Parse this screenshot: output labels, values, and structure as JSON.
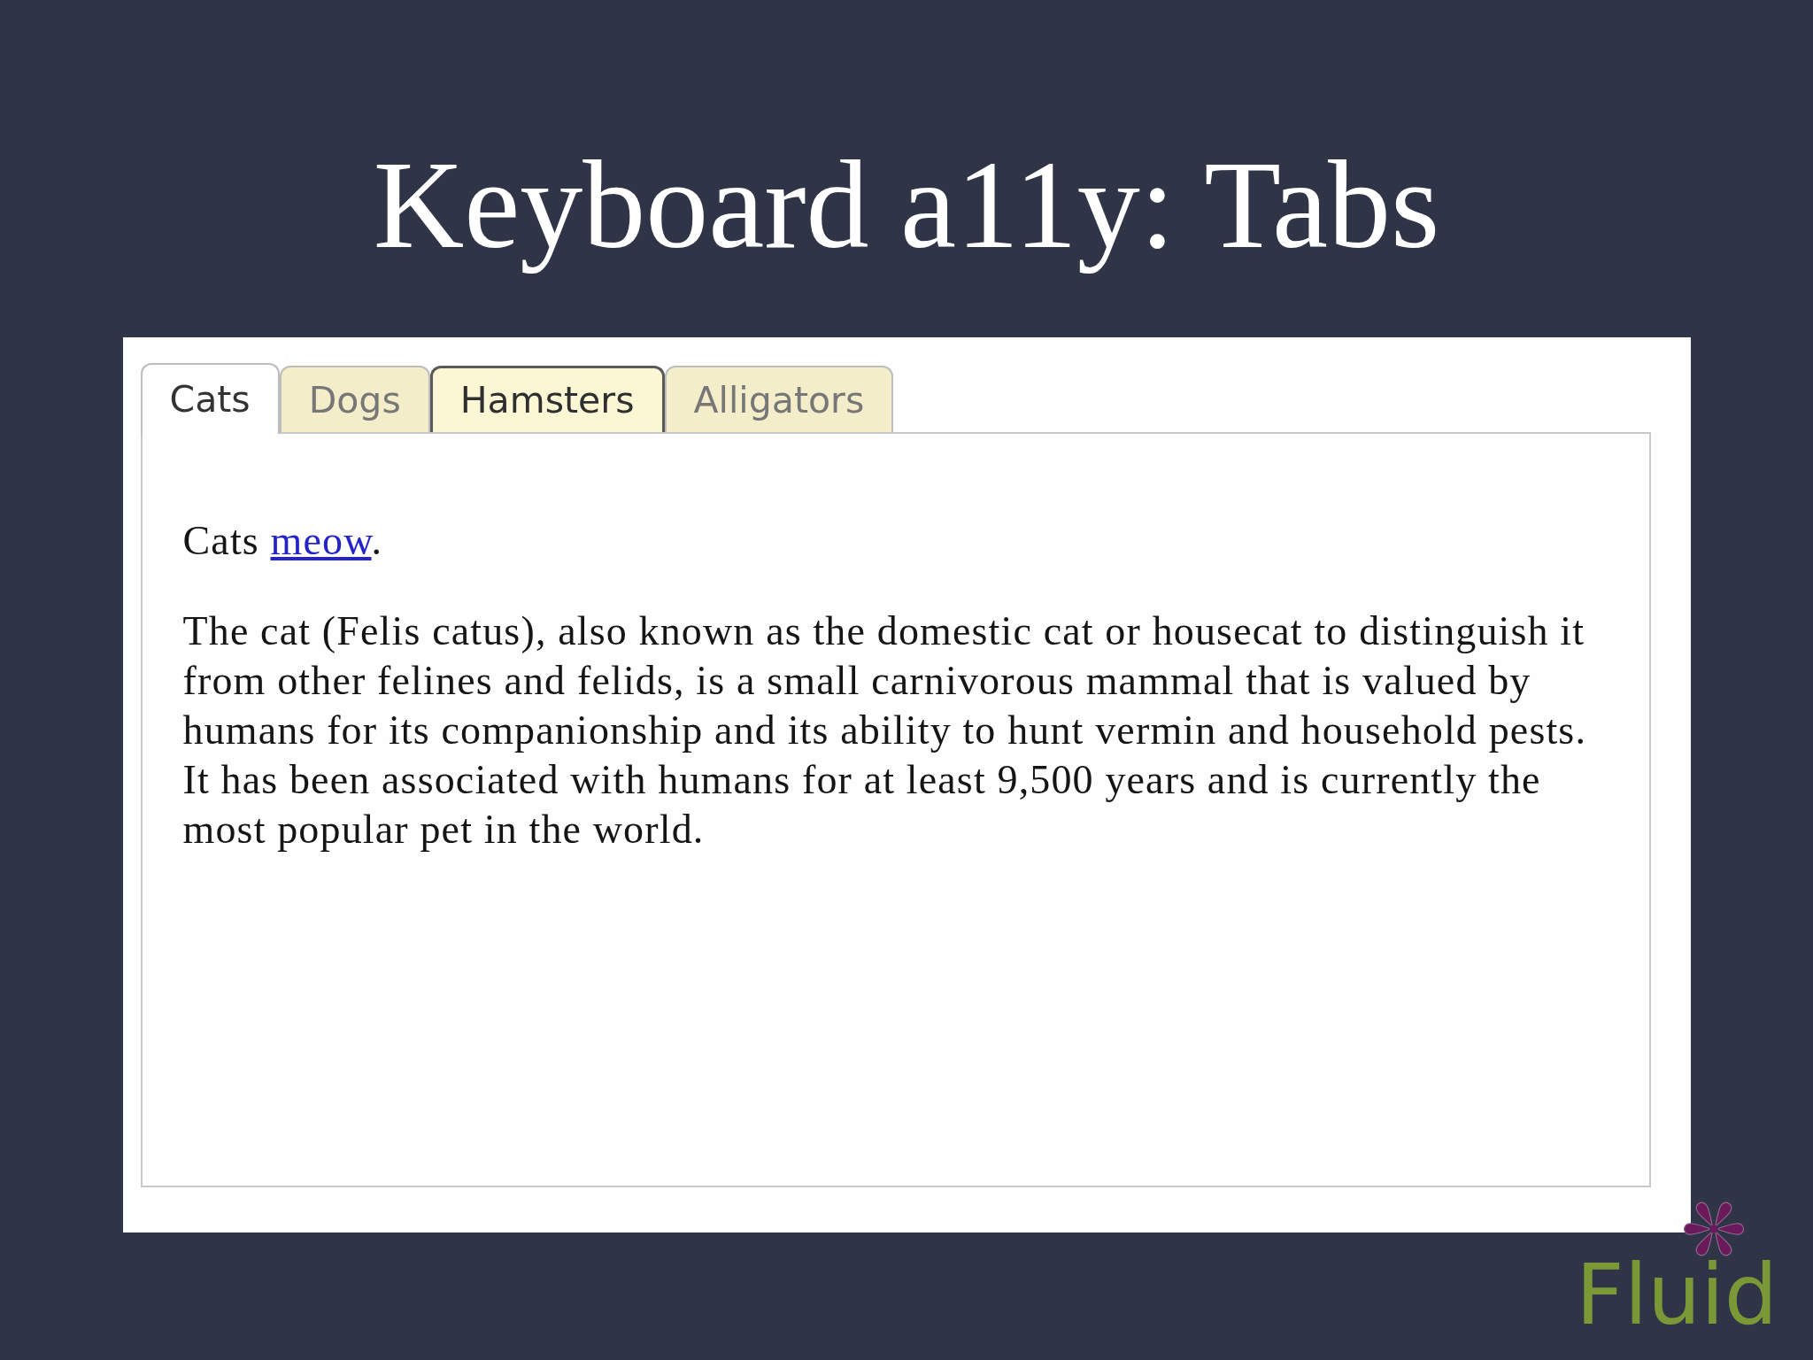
{
  "slide": {
    "title": "Keyboard a11y: Tabs"
  },
  "tabs": [
    {
      "label": "Cats",
      "selected": true,
      "focused": false
    },
    {
      "label": "Dogs",
      "selected": false,
      "focused": false
    },
    {
      "label": "Hamsters",
      "selected": false,
      "focused": true
    },
    {
      "label": "Alligators",
      "selected": false,
      "focused": false
    }
  ],
  "tab_panel": {
    "intro": {
      "text": "Cats",
      "link": "meow",
      "end": "."
    },
    "paragraph": "The cat (Felis catus), also known as the domestic cat or housecat to distinguish it from other felines and felids, is a small carnivorous mammal that is valued by humans for its companionship and its ability to hunt vermin and household pests. It has been associated with humans for at least 9,500 years and is currently the most popular pet in the world."
  },
  "logo": {
    "text": "Fluid"
  }
}
